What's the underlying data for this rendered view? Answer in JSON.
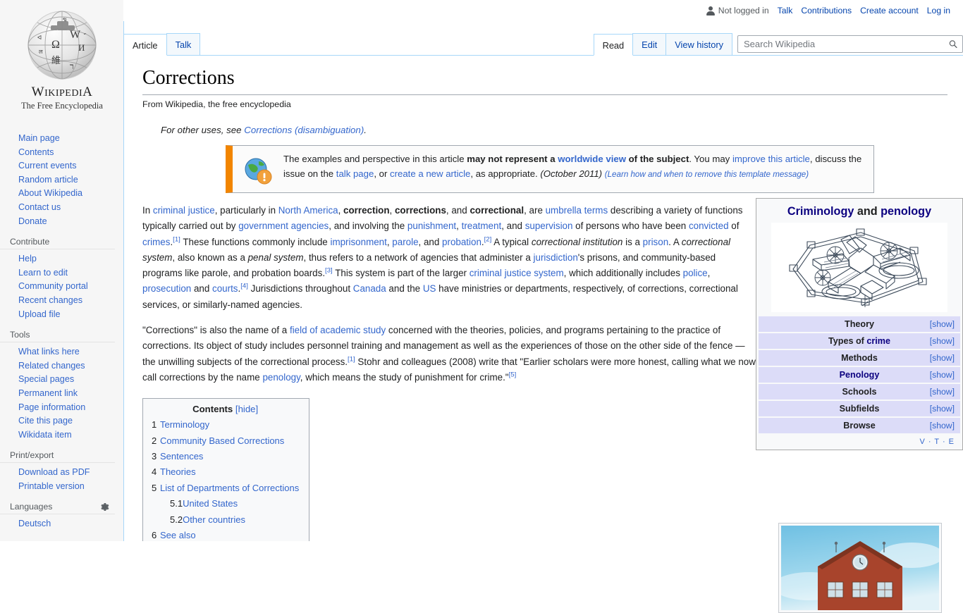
{
  "personal_bar": {
    "user_status": "Not logged in",
    "links": [
      "Talk",
      "Contributions",
      "Create account",
      "Log in"
    ]
  },
  "sidebar": {
    "logo": {
      "wordmark_w": "W",
      "wordmark_rest": "IKIPEDI",
      "wordmark_a": "A",
      "tagline": "The Free Encyclopedia"
    },
    "portals": [
      {
        "heading": "",
        "items": [
          "Main page",
          "Contents",
          "Current events",
          "Random article",
          "About Wikipedia",
          "Contact us",
          "Donate"
        ]
      },
      {
        "heading": "Contribute",
        "items": [
          "Help",
          "Learn to edit",
          "Community portal",
          "Recent changes",
          "Upload file"
        ]
      },
      {
        "heading": "Tools",
        "items": [
          "What links here",
          "Related changes",
          "Special pages",
          "Permanent link",
          "Page information",
          "Cite this page",
          "Wikidata item"
        ]
      },
      {
        "heading": "Print/export",
        "items": [
          "Download as PDF",
          "Printable version"
        ]
      },
      {
        "heading": "Languages",
        "has_gear": true,
        "items": [
          "Deutsch"
        ]
      }
    ]
  },
  "tabs": {
    "namespace": [
      {
        "label": "Article",
        "active": true
      },
      {
        "label": "Talk",
        "active": false
      }
    ],
    "views": [
      {
        "label": "Read",
        "active": true
      },
      {
        "label": "Edit",
        "active": false
      },
      {
        "label": "View history",
        "active": false
      }
    ]
  },
  "search": {
    "placeholder": "Search Wikipedia",
    "value": ""
  },
  "article": {
    "title": "Corrections",
    "site_sub": "From Wikipedia, the free encyclopedia",
    "hatnote": {
      "prefix": "For other uses, see ",
      "link": "Corrections (disambiguation)",
      "suffix": "."
    },
    "ambox": {
      "t1": "The examples and perspective in this article ",
      "b1": "may not represent a ",
      "l1": "worldwide view",
      "b2": " of the subject",
      "t2": ". You may ",
      "l2": "improve this article",
      "t3": ", discuss the issue on the ",
      "l3": "talk page",
      "t4": ", or ",
      "l4": "create a new article",
      "t5": ", as appropriate. ",
      "date": "(October 2011)",
      "learn": "(Learn how and when to remove this template message)"
    },
    "paragraph1": {
      "s1": "In ",
      "l1": "criminal justice",
      "s2": ", particularly in ",
      "l2": "North America",
      "s3": ", ",
      "b1": "correction",
      "s4": ", ",
      "b2": "corrections",
      "s5": ", and ",
      "b3": "correctional",
      "s6": ", are ",
      "l3": "umbrella terms",
      "s7": " describing a variety of functions typically carried out by ",
      "l4": "government agencies",
      "s8": ", and involving the ",
      "l5": "punishment",
      "s9": ", ",
      "l6": "treatment",
      "s10": ", and ",
      "l7": "supervision",
      "s11": " of persons who have been ",
      "l8": "convicted",
      "s12": " of ",
      "l9": "crimes",
      "s13": ".",
      "r1": "[1]",
      "s14": " These functions commonly include ",
      "l10": "imprisonment",
      "s15": ", ",
      "l11": "parole",
      "s16": ", and ",
      "l12": "probation",
      "s17": ".",
      "r2": "[2]",
      "s18": " A typical ",
      "i1": "correctional institution",
      "s19": " is a ",
      "l13": "prison",
      "s20": ". A ",
      "i2": "correctional system",
      "s21": ", also known as a ",
      "i3": "penal system",
      "s22": ", thus refers to a network of agencies that administer a ",
      "l14": "jurisdiction",
      "s23": "'s prisons, and community-based programs like parole, and probation boards.",
      "r3": "[3]",
      "s24": " This system is part of the larger ",
      "l15": "criminal justice system",
      "s25": ", which additionally includes ",
      "l16": "police",
      "s26": ", ",
      "l17": "prosecution",
      "s27": " and ",
      "l18": "courts",
      "s28": ".",
      "r4": "[4]",
      "s29": " Jurisdictions throughout ",
      "l19": "Canada",
      "s30": " and the ",
      "l20": "US",
      "s31": " have ministries or departments, respectively, of corrections, correctional services, or similarly-named agencies."
    },
    "paragraph2": {
      "s1": "\"Corrections\" is also the name of a ",
      "l1": "field of academic study",
      "s2": " concerned with the theories, policies, and programs pertaining to the practice of corrections. Its object of study includes personnel training and management as well as the experiences of those on the other side of the fence — the unwilling subjects of the correctional process.",
      "r1": "[1]",
      "s3": " Stohr and colleagues (2008) write that \"Earlier scholars were more honest, calling what we now call corrections by the name ",
      "l2": "penology",
      "s4": ", which means the study of punishment for crime.\"",
      "r2": "[5]"
    },
    "toc": {
      "title": "Contents",
      "toggle": "[hide]",
      "entries": [
        {
          "num": "1",
          "label": "Terminology",
          "level": 1
        },
        {
          "num": "2",
          "label": "Community Based Corrections",
          "level": 1
        },
        {
          "num": "3",
          "label": "Sentences",
          "level": 1
        },
        {
          "num": "4",
          "label": "Theories",
          "level": 1
        },
        {
          "num": "5",
          "label": "List of Departments of Corrections",
          "level": 1
        },
        {
          "num": "5.1",
          "label": "United States",
          "level": 2
        },
        {
          "num": "5.2",
          "label": "Other countries",
          "level": 2
        },
        {
          "num": "6",
          "label": "See also",
          "level": 1
        }
      ]
    }
  },
  "infobox": {
    "title_part1": "Criminology",
    "title_and": " and ",
    "title_part2": "penology",
    "image_alt": "panopticon-prison-diagram",
    "rows": [
      {
        "label": "Theory",
        "toggle": "[show]",
        "linked": false
      },
      {
        "label": "Types of crime",
        "toggle": "[show]",
        "linked": true
      },
      {
        "label": "Methods",
        "toggle": "[show]",
        "linked": false
      },
      {
        "label": "Penology",
        "toggle": "[show]",
        "linked": true
      },
      {
        "label": "Schools",
        "toggle": "[show]",
        "linked": false
      },
      {
        "label": "Subfields",
        "toggle": "[show]",
        "linked": false
      },
      {
        "label": "Browse",
        "toggle": "[show]",
        "linked": false
      }
    ],
    "footer": "V · T · E"
  },
  "bottom_thumb": {
    "alt": "brick-building-with-clock-photo"
  },
  "colors": {
    "link": "#3366cc",
    "link_alt": "#0645ad",
    "accent_border": "#a7d7f9",
    "ambox_orange": "#f28500",
    "infobox_row": "#dcdcf8",
    "infobox_title": "#0b0080"
  }
}
